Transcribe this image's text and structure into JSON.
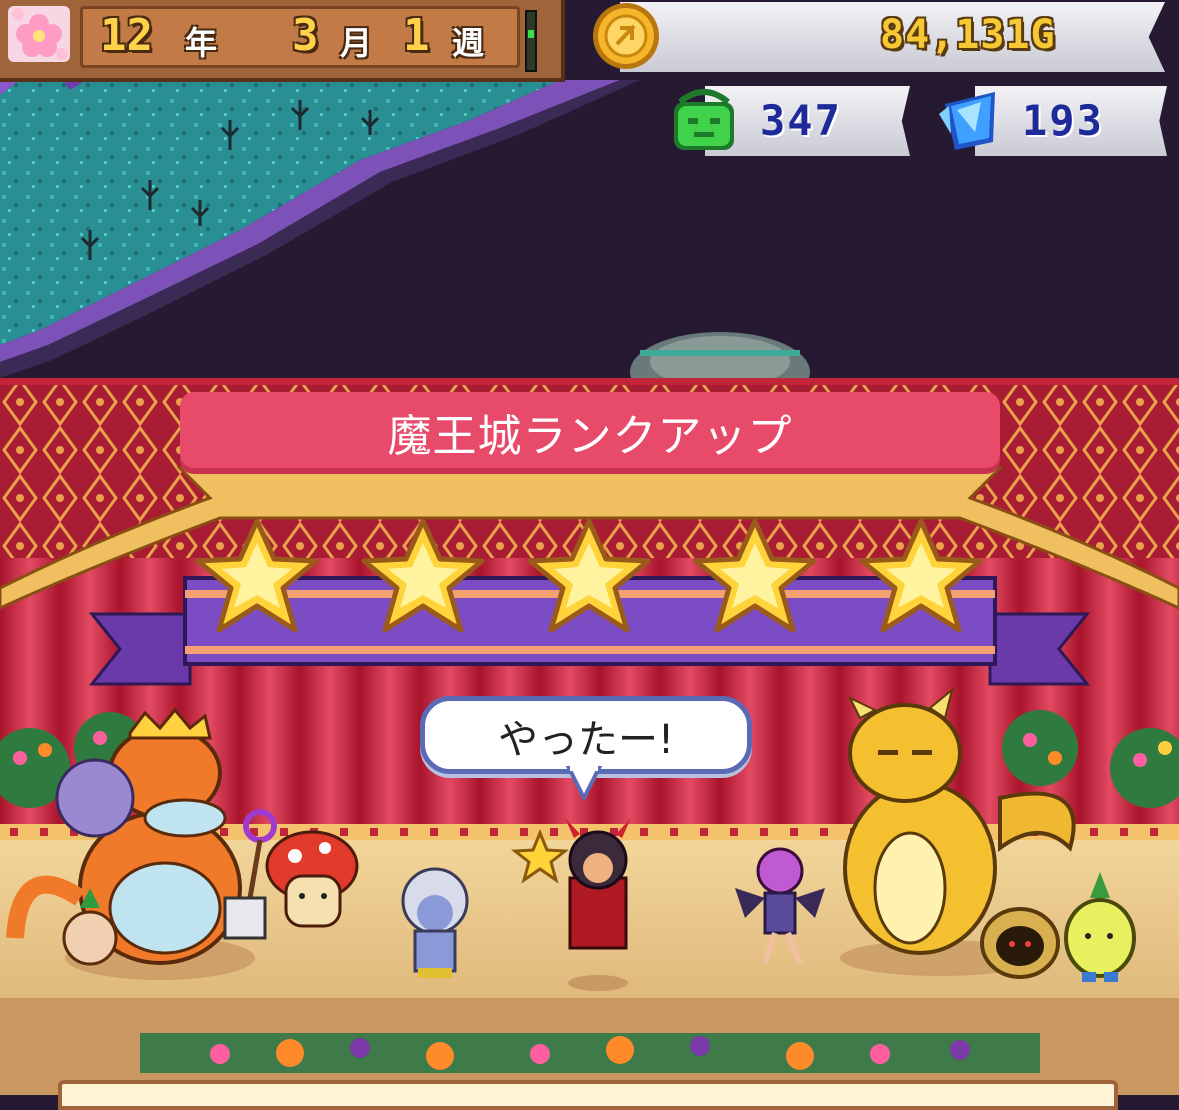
{
  "header": {
    "year_value": "12",
    "year_unit": "年",
    "month_value": "3",
    "month_unit": "月",
    "week_value": "1",
    "week_unit": "週"
  },
  "resources": {
    "gold": "84,131G",
    "bag_count": "347",
    "crystal_count": "193"
  },
  "event": {
    "title": "魔王城ランクアップ",
    "rank_stars": 5,
    "speech": "やったー!"
  },
  "icons": [
    "flower-icon",
    "coin-icon",
    "bag-icon",
    "crystal-icon",
    "star-icon"
  ],
  "colors": {
    "banner": "#e84a6a",
    "gold_text": "#f6c833",
    "resource_text": "#1f2a9a",
    "stage_curtain": "#c2243a",
    "ribbon": "#6a3aa8"
  }
}
